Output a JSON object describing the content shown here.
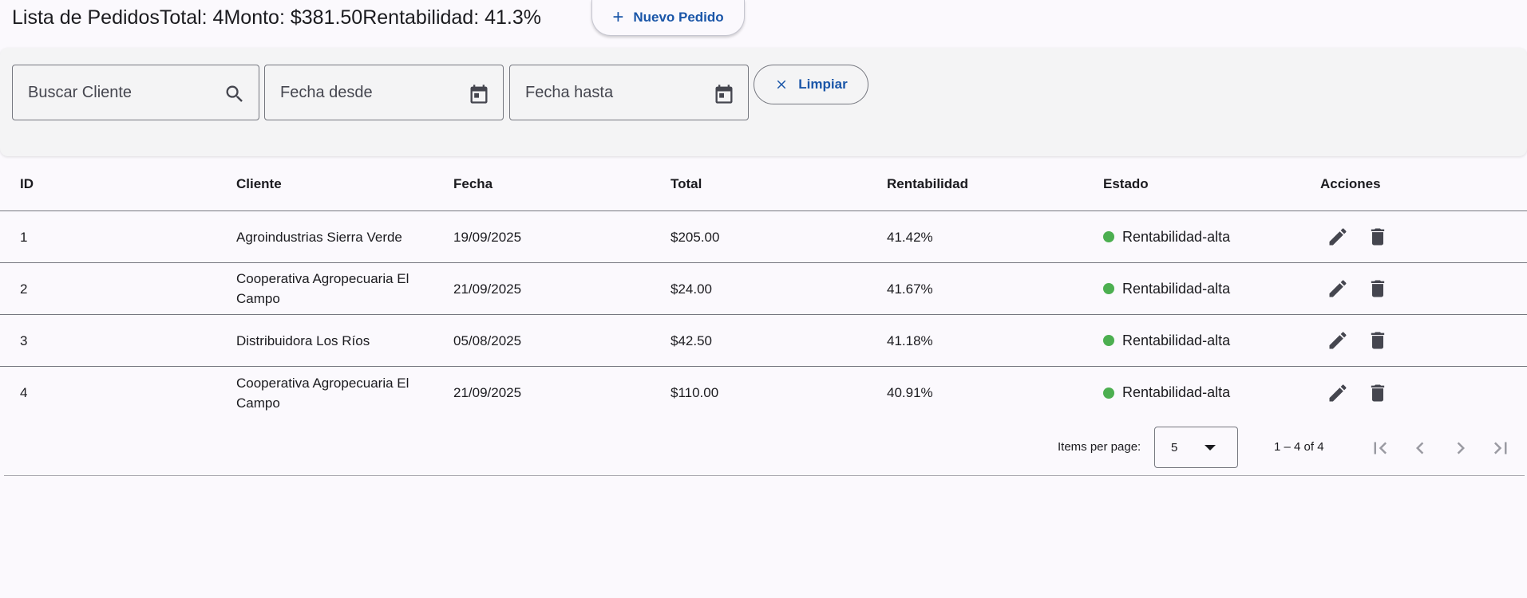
{
  "header": {
    "title": "Lista de Pedidos",
    "total": "Total: 4",
    "monto": "Monto: $381.50",
    "rentabilidad": "Rentabilidad: 41.3%",
    "new_button": "Nuevo Pedido"
  },
  "filters": {
    "search_placeholder": "Buscar Cliente",
    "date_from_placeholder": "Fecha desde",
    "date_to_placeholder": "Fecha hasta",
    "clear_button": "Limpiar"
  },
  "table": {
    "columns": [
      "ID",
      "Cliente",
      "Fecha",
      "Total",
      "Rentabilidad",
      "Estado",
      "Acciones"
    ],
    "rows": [
      {
        "id": "1",
        "cliente": "Agroindustrias Sierra Verde",
        "fecha": "19/09/2025",
        "total": "$205.00",
        "rentabilidad": "41.42%",
        "estado": "Rentabilidad-alta"
      },
      {
        "id": "2",
        "cliente": "Cooperativa Agropecuaria El Campo",
        "fecha": "21/09/2025",
        "total": "$24.00",
        "rentabilidad": "41.67%",
        "estado": "Rentabilidad-alta"
      },
      {
        "id": "3",
        "cliente": "Distribuidora Los Ríos",
        "fecha": "05/08/2025",
        "total": "$42.50",
        "rentabilidad": "41.18%",
        "estado": "Rentabilidad-alta"
      },
      {
        "id": "4",
        "cliente": "Cooperativa Agropecuaria El Campo",
        "fecha": "21/09/2025",
        "total": "$110.00",
        "rentabilidad": "40.91%",
        "estado": "Rentabilidad-alta"
      }
    ]
  },
  "paginator": {
    "items_per_page_label": "Items per page:",
    "items_per_page_value": "5",
    "range": "1 – 4 of 4"
  },
  "colors": {
    "accent": "#1a56a8",
    "status_green": "#4caf50",
    "background": "#fbf9fd"
  },
  "icons": {
    "add": "plus-icon",
    "search": "search-icon",
    "calendar": "calendar-icon",
    "clear": "close-icon",
    "edit": "pencil-icon",
    "delete": "trash-icon",
    "first": "first-page-icon",
    "prev": "chevron-left-icon",
    "next": "chevron-right-icon",
    "last": "last-page-icon"
  }
}
